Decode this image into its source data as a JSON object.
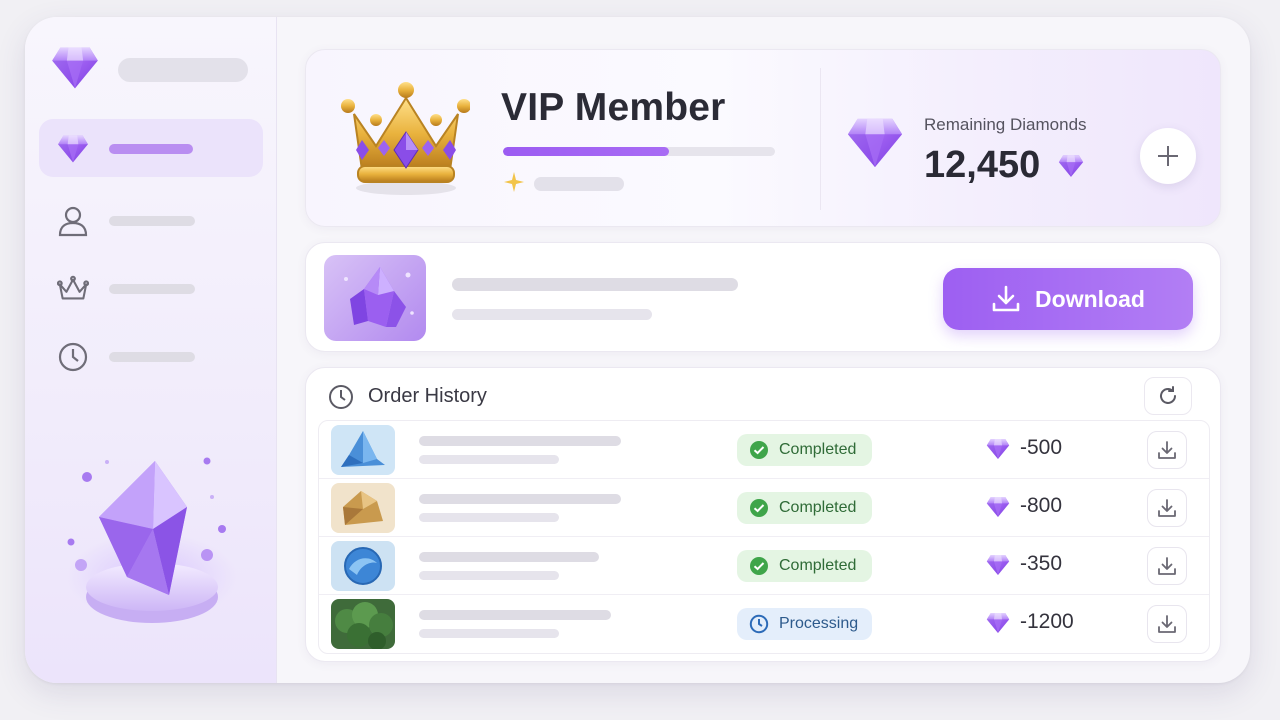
{
  "vip": {
    "title": "VIP Member",
    "progress": 0.61
  },
  "balance": {
    "label": "Remaining Diamonds",
    "value": "12,450"
  },
  "download": {
    "button_label": "Download"
  },
  "orders": {
    "title": "Order History",
    "rows": [
      {
        "thumb": "ice-crystal",
        "status": "Completed",
        "status_type": "completed",
        "amount": "-500"
      },
      {
        "thumb": "gold-rock",
        "status": "Completed",
        "status_type": "completed",
        "amount": "-800"
      },
      {
        "thumb": "water-orb",
        "status": "Completed",
        "status_type": "completed",
        "amount": "-350"
      },
      {
        "thumb": "forest",
        "status": "Processing",
        "status_type": "processing",
        "amount": "-1200"
      }
    ]
  },
  "colors": {
    "accent": "#9d5ff2",
    "completed_bg": "#e4f5e3",
    "processing_bg": "#e4eefb"
  },
  "icons": {
    "sidebar": [
      "diamond-icon",
      "user-icon",
      "crown-icon",
      "clock-icon"
    ]
  }
}
